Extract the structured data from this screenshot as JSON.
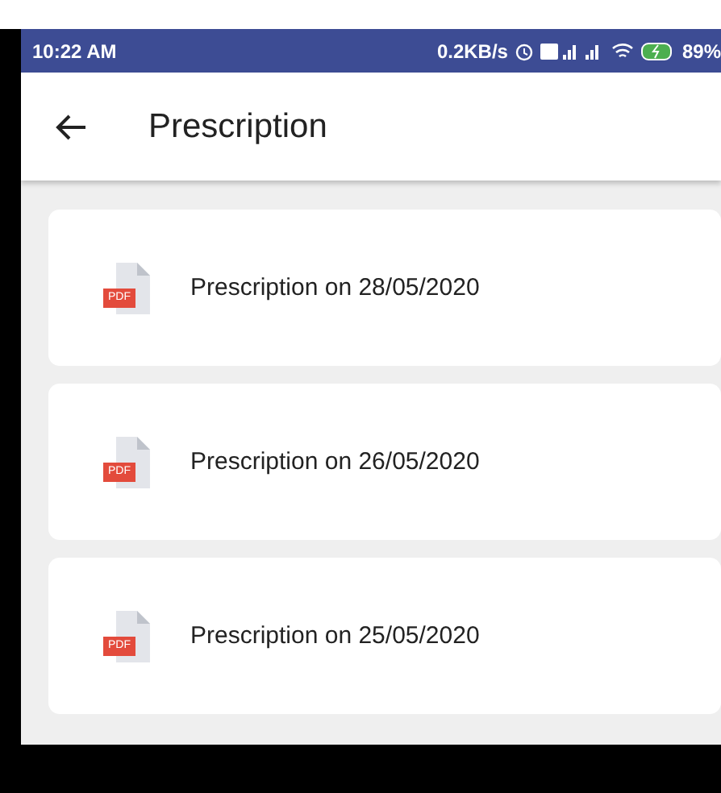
{
  "status_bar": {
    "time": "10:22 AM",
    "speed": "0.2KB/s",
    "battery": "89%"
  },
  "app_bar": {
    "title": "Prescription"
  },
  "prescriptions": [
    {
      "badge": "PDF",
      "label": "Prescription on 28/05/2020"
    },
    {
      "badge": "PDF",
      "label": "Prescription on 26/05/2020"
    },
    {
      "badge": "PDF",
      "label": "Prescription on 25/05/2020"
    }
  ]
}
